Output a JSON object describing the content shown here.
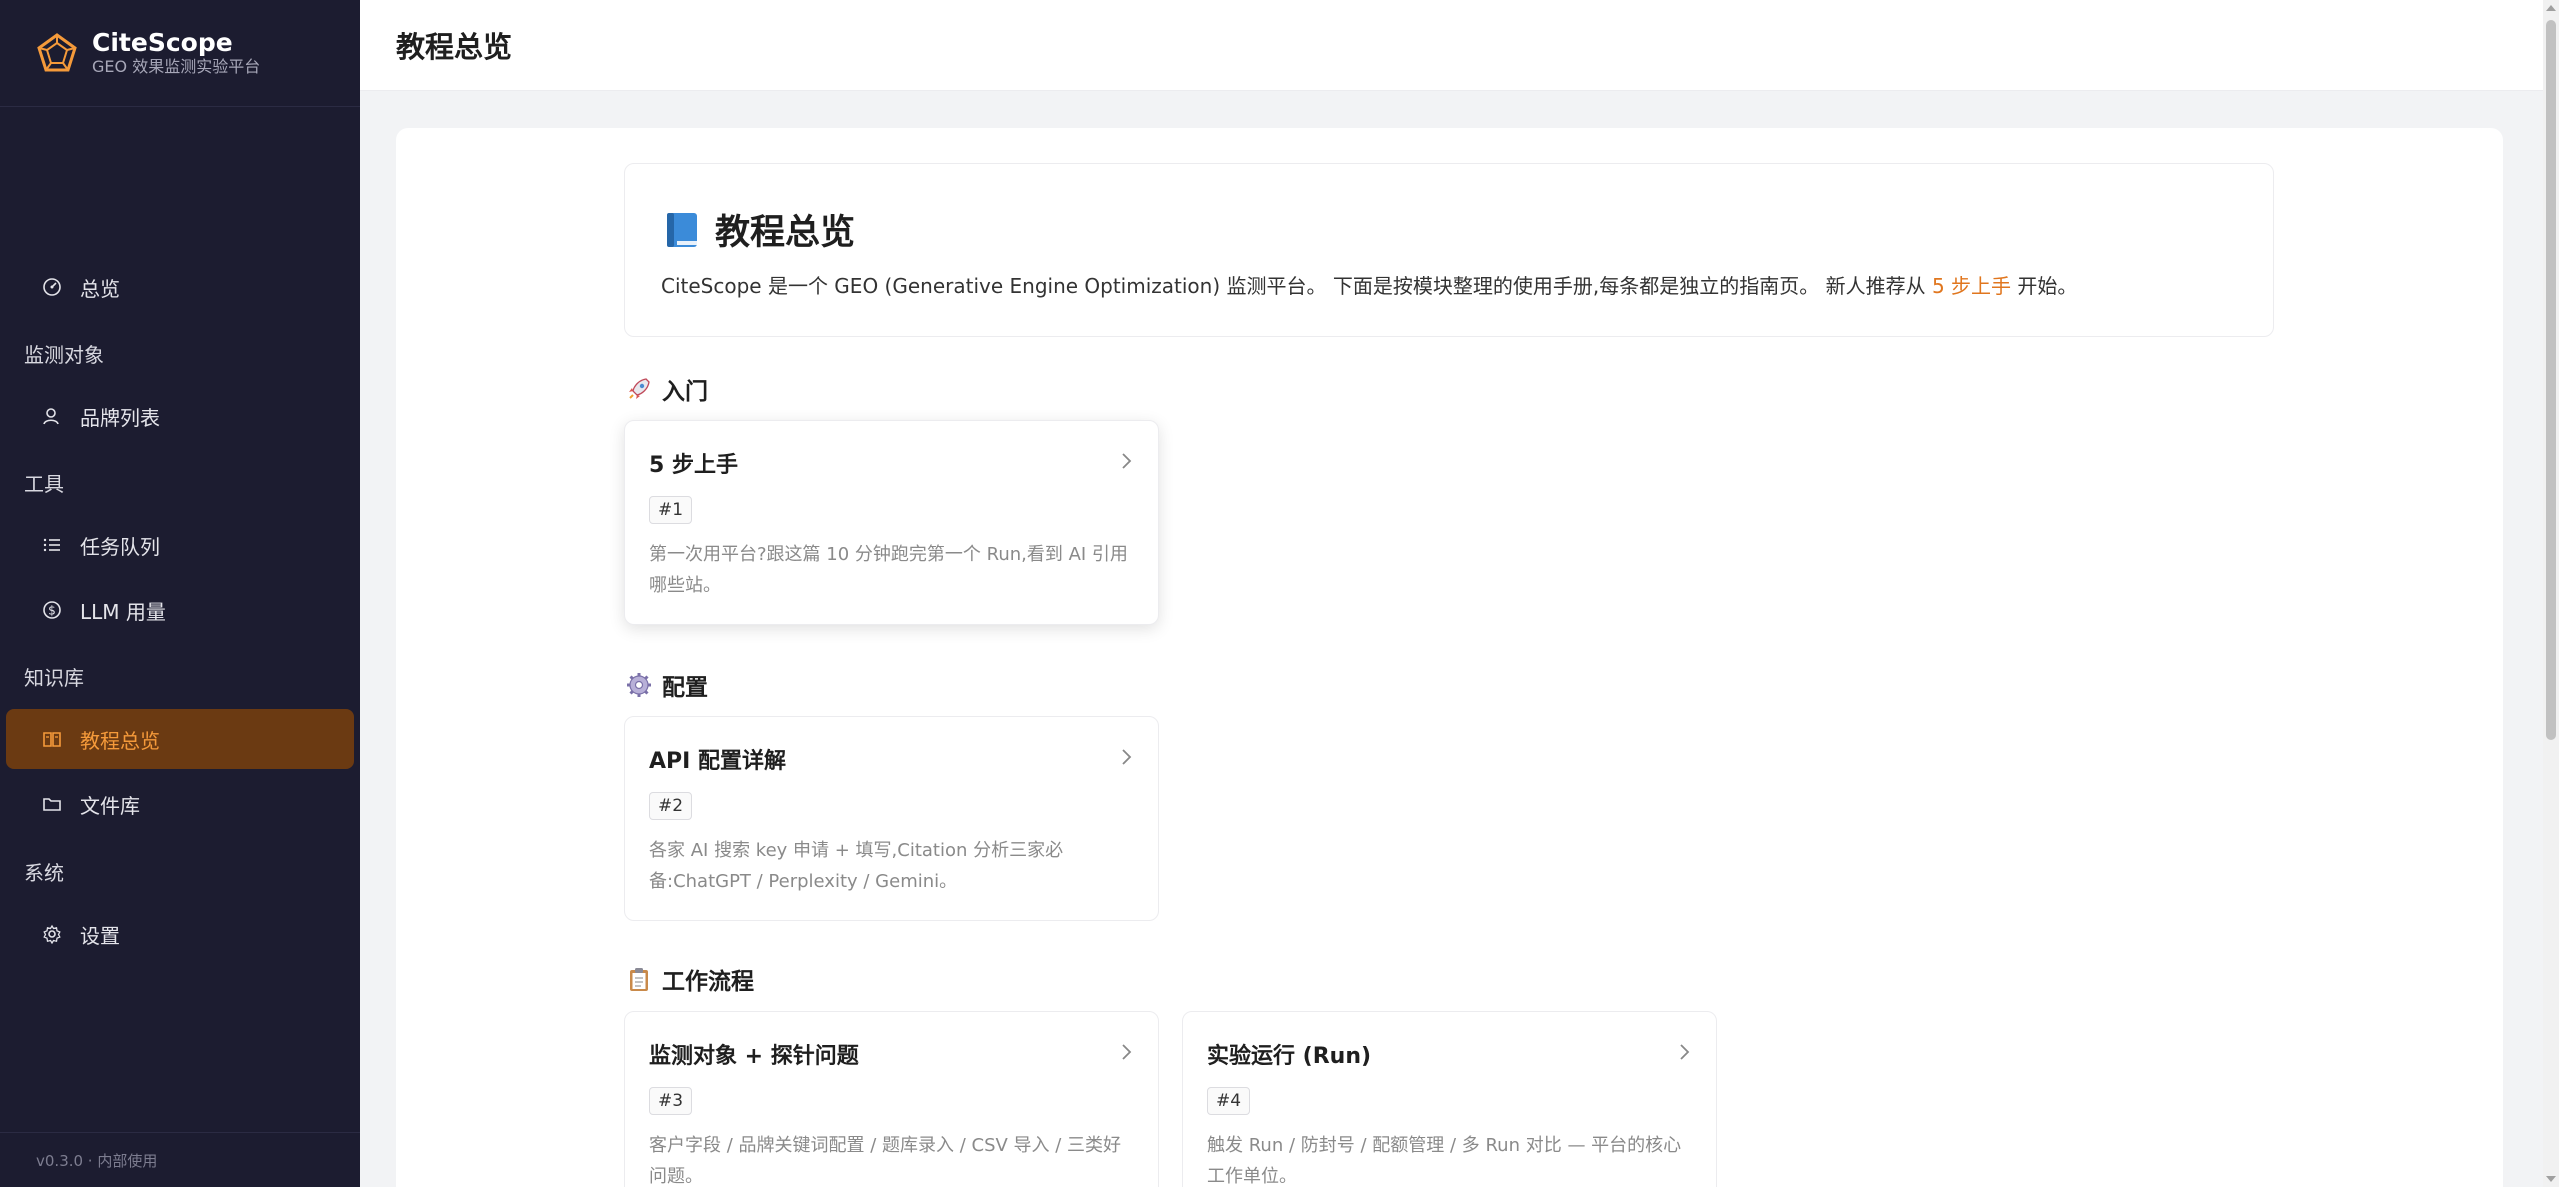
{
  "brand": {
    "name": "CiteScope",
    "subtitle": "GEO 效果监测实验平台"
  },
  "sidebar": {
    "items": [
      {
        "label": "总览",
        "icon": "dashboard-icon"
      },
      {
        "label": "品牌列表",
        "icon": "user-icon"
      },
      {
        "label": "任务队列",
        "icon": "list-icon"
      },
      {
        "label": "LLM 用量",
        "icon": "dollar-icon"
      },
      {
        "label": "教程总览",
        "icon": "book-open-icon",
        "active": true
      },
      {
        "label": "文件库",
        "icon": "folder-icon"
      },
      {
        "label": "设置",
        "icon": "gear-icon"
      }
    ],
    "sections": [
      "监测对象",
      "工具",
      "知识库",
      "系统"
    ],
    "version": "v0.3.0 · 内部使用"
  },
  "header": {
    "title": "教程总览"
  },
  "intro": {
    "title": "教程总览",
    "desc_before": "CiteScope 是一个 GEO (Generative Engine Optimization) 监测平台。 下面是按模块整理的使用手册,每条都是独立的指南页。 新人推荐从 ",
    "desc_link": "5 步上手",
    "desc_after": " 开始。"
  },
  "sections": [
    {
      "title": "入门",
      "icon": "rocket-icon",
      "cards": [
        {
          "title": "5 步上手",
          "tag": "#1",
          "desc": "第一次用平台?跟这篇 10 分钟跑完第一个 Run,看到 AI 引用哪些站。"
        }
      ]
    },
    {
      "title": "配置",
      "icon": "gear-icon",
      "cards": [
        {
          "title": "API 配置详解",
          "tag": "#2",
          "desc": "各家 AI 搜索 key 申请 + 填写,Citation 分析三家必备:ChatGPT / Perplexity / Gemini。"
        }
      ]
    },
    {
      "title": "工作流程",
      "icon": "clipboard-icon",
      "cards": [
        {
          "title": "监测对象 + 探针问题",
          "tag": "#3",
          "desc": "客户字段 / 品牌关键词配置 / 题库录入 / CSV 导入 / 三类好问题。"
        },
        {
          "title": "实验运行 (Run)",
          "tag": "#4",
          "desc": "触发 Run / 防封号 / 配额管理 / 多 Run 对比 — 平台的核心工作单位。"
        }
      ]
    }
  ],
  "colors": {
    "sidebar_bg": "#1c1c30",
    "accent": "#f59a3a",
    "active_bg": "#6b3a12",
    "link": "#e0761e"
  }
}
